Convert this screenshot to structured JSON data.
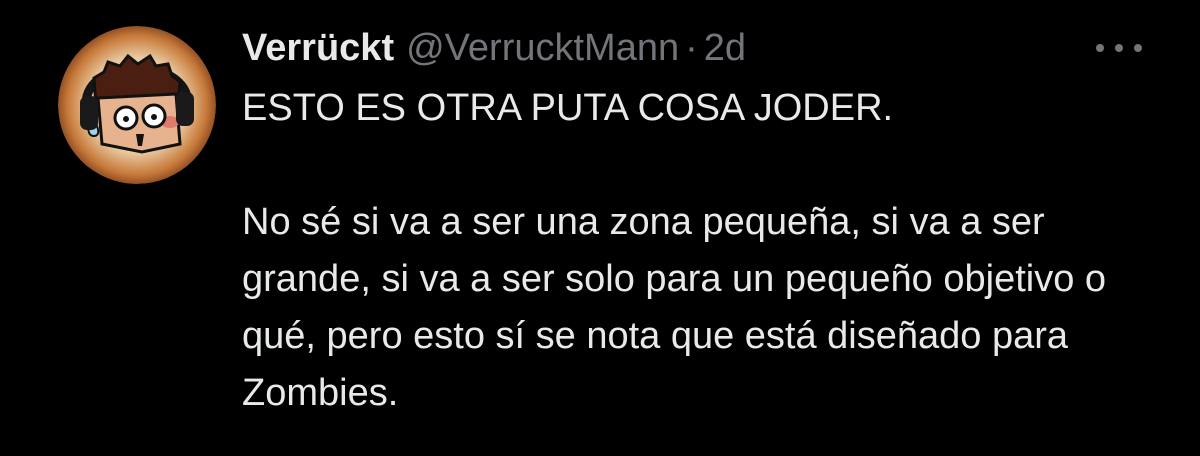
{
  "tweet": {
    "display_name": "Verrückt",
    "handle": "@VerrucktMann",
    "separator": "·",
    "time": "2d",
    "paragraphs": [
      "ESTO ES OTRA PUTA COSA JODER.",
      "No sé si va a ser una zona pequeña, si va a ser grande, si va a ser solo para un pequeño objetivo o qué, pero esto sí se nota que está diseñado para Zombies."
    ],
    "avatar_icon": "cartoon-face-headphones-icon",
    "more_icon": "more-options-icon"
  },
  "colors": {
    "background": "#000000",
    "primary_text": "#e7e9ea",
    "secondary_text": "#71767b"
  }
}
